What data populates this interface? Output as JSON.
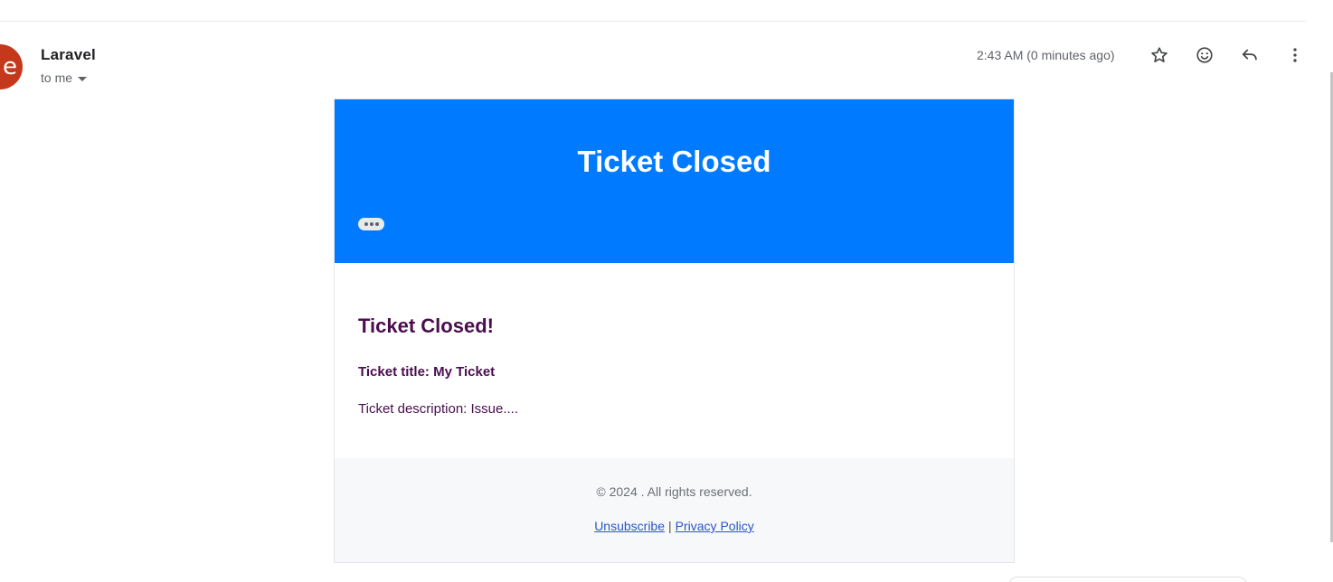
{
  "message": {
    "avatar_letter": "e",
    "sender": "Laravel",
    "recipient": "to me",
    "timestamp": "2:43 AM (0 minutes ago)",
    "avatar_color": "#c5381b"
  },
  "actions": {
    "star": "star-icon",
    "emoji": "emoji-icon",
    "reply": "reply-icon",
    "more": "more-vert-icon"
  },
  "email": {
    "header_title": "Ticket Closed",
    "header_color": "#007bff",
    "heading": "Ticket Closed!",
    "ticket_title": "Ticket title: My Ticket",
    "ticket_description": "Ticket description: Issue....",
    "body_text_color": "#4a0d4e",
    "copyright": "© 2024 . All rights reserved.",
    "unsubscribe_label": "Unsubscribe",
    "separator": "|",
    "privacy_label": "Privacy Policy"
  }
}
